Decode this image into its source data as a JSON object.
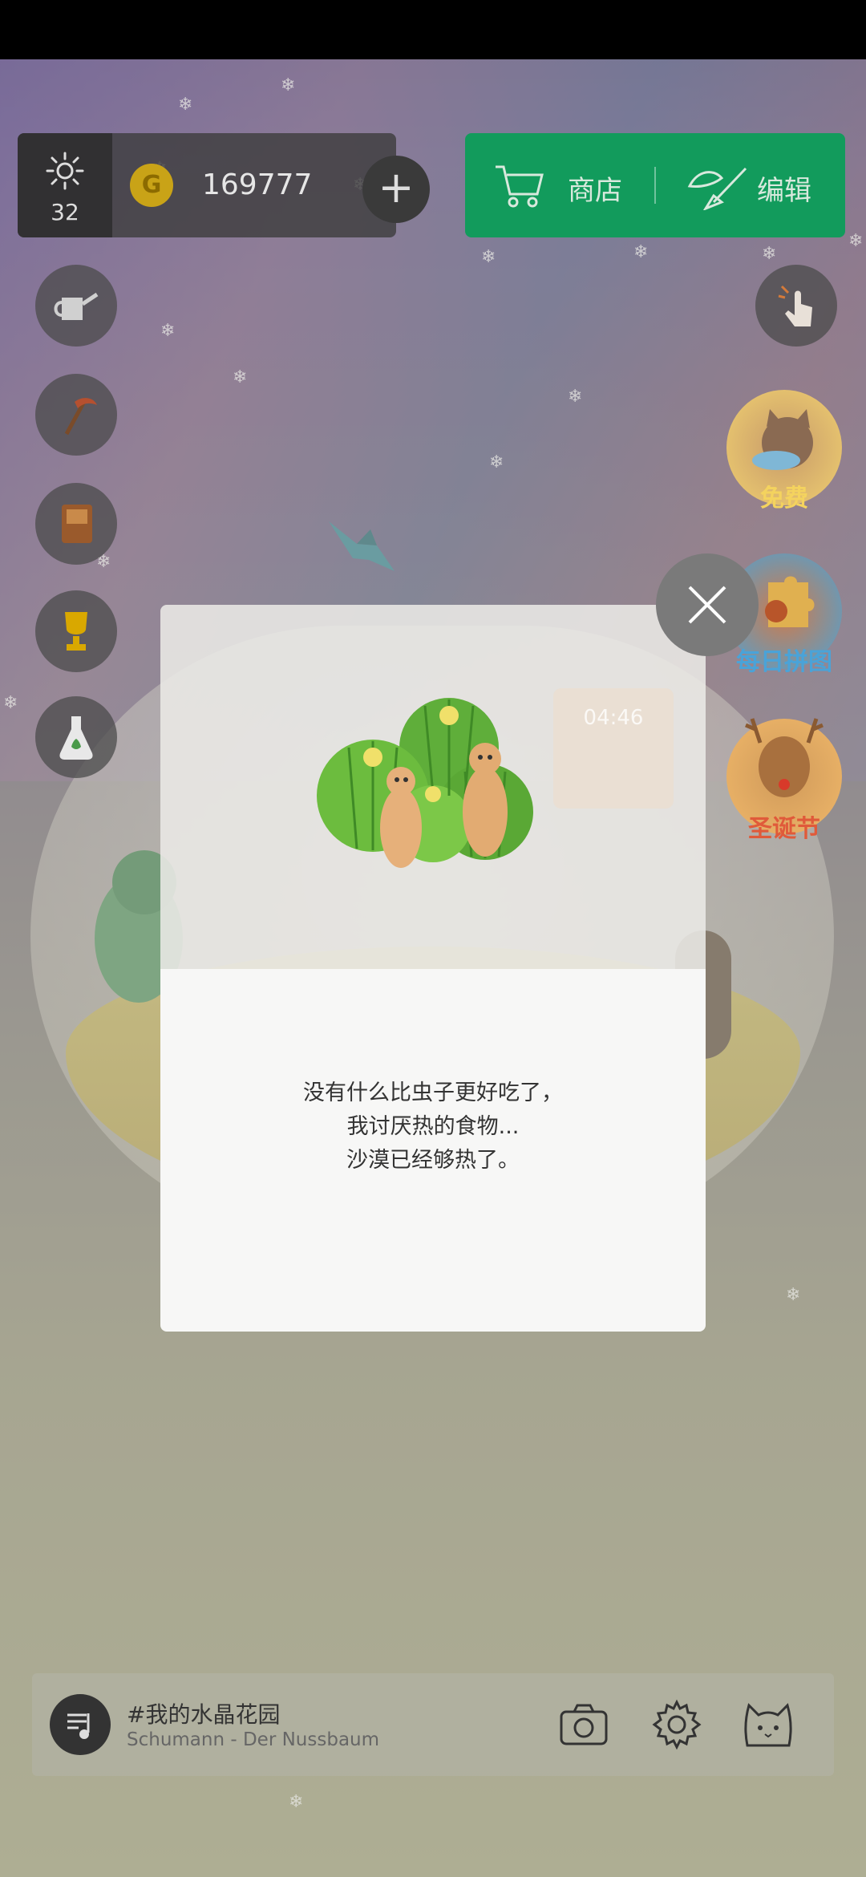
{
  "hud": {
    "sun_count": "32",
    "coin_letter": "G",
    "coin_count": "169777",
    "plus_symbol": "+",
    "shop_label": "商店",
    "edit_label": "编辑"
  },
  "events": [
    {
      "label": "免费",
      "color": "#f4d35e"
    },
    {
      "label": "每日拼图",
      "color": "#4aa3d8"
    },
    {
      "label": "圣诞节",
      "color": "#e05a3a"
    }
  ],
  "dialog": {
    "lines": [
      "没有什么比虫子更好吃了，",
      "我讨厌热的食物...",
      "沙漠已经够热了。"
    ]
  },
  "background_clock": "04:46",
  "music": {
    "title": "#我的水晶花园",
    "artist": "Schumann - Der Nussbaum"
  },
  "colors": {
    "shop_green": "#129b5c",
    "overlay_gray": "#7a7a7a"
  }
}
